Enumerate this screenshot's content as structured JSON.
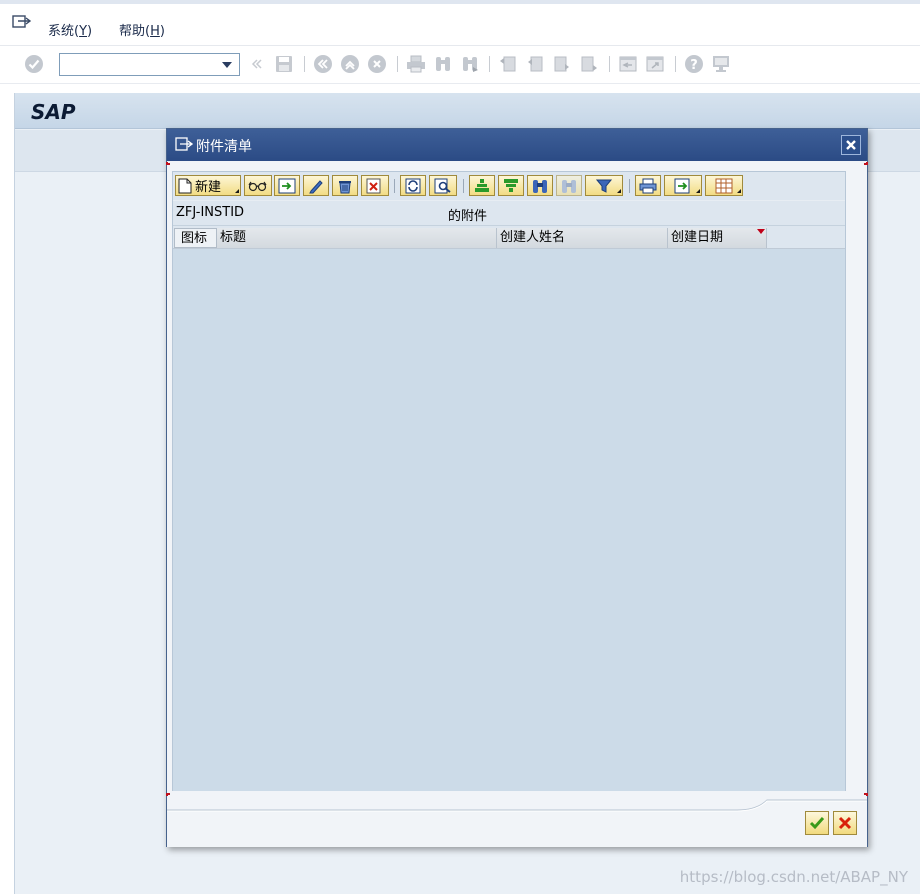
{
  "menubar": {
    "items": [
      {
        "label": "系统(",
        "key": "Y",
        "end": ")"
      },
      {
        "label": "帮助(",
        "key": "H",
        "end": ")"
      }
    ]
  },
  "toolbar": {
    "command_value": "",
    "icons": [
      "enter-icon",
      "command-field",
      "back-icon",
      "save-icon",
      "back-nav-icon",
      "exit-icon",
      "cancel-icon",
      "print-icon",
      "find-icon",
      "find-next-icon",
      "first-page-icon",
      "prev-page-icon",
      "next-page-icon",
      "last-page-icon",
      "new-session-icon",
      "shortcut-icon",
      "help-icon",
      "layout-icon"
    ]
  },
  "screen": {
    "title": "SAP"
  },
  "dialog": {
    "title": "附件清单",
    "toolbar": {
      "new_label": "新建"
    },
    "caption_left": "ZFJ-INSTID",
    "caption_right": "的附件",
    "columns": [
      {
        "label": "图标"
      },
      {
        "label": "标题"
      },
      {
        "label": "创建人姓名"
      },
      {
        "label": "创建日期"
      }
    ],
    "rows": []
  },
  "colors": {
    "dialog_header": "#2b4b85",
    "grid_background": "#ccdbe8",
    "button_yellow": "#f2dc84",
    "ok_green": "#3a9a1a",
    "cancel_red": "#d8200c"
  },
  "watermark": "https://blog.csdn.net/ABAP_NY"
}
